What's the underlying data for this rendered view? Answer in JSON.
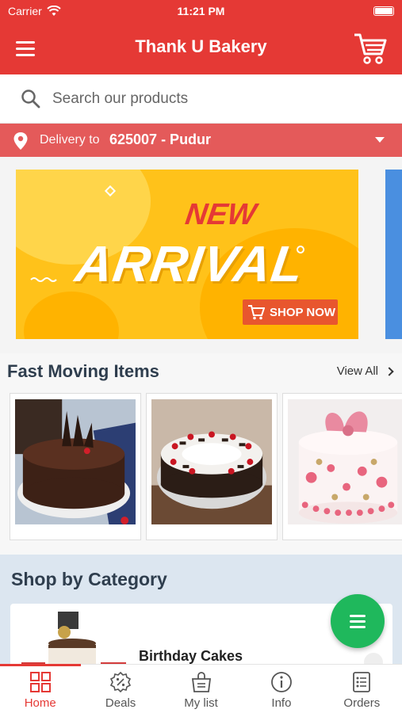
{
  "status_bar": {
    "carrier": "Carrier",
    "time": "11:21 PM"
  },
  "header": {
    "title": "Thank U Bakery"
  },
  "search": {
    "placeholder": "Search our products"
  },
  "delivery": {
    "label": "Delivery to",
    "location": "625007 - Pudur"
  },
  "banner": {
    "line1": "NEW",
    "line2": "ARRIVAL",
    "cta": "SHOP NOW"
  },
  "fast_moving": {
    "title": "Fast Moving Items",
    "view_all": "View All",
    "items": [
      {
        "icon": "chocolate-cake-image"
      },
      {
        "icon": "black-forest-cake-image"
      },
      {
        "icon": "pink-fondant-cake-image"
      }
    ]
  },
  "categories": {
    "title": "Shop by Category",
    "items": [
      {
        "name": "Birthday Cakes"
      }
    ]
  },
  "tabs": [
    {
      "label": "Home",
      "icon": "home-grid-icon",
      "active": true
    },
    {
      "label": "Deals",
      "icon": "deals-badge-icon",
      "active": false
    },
    {
      "label": "My list",
      "icon": "shopping-bag-icon",
      "active": false
    },
    {
      "label": "Info",
      "icon": "info-icon",
      "active": false
    },
    {
      "label": "Orders",
      "icon": "orders-icon",
      "active": false
    }
  ],
  "colors": {
    "primary": "#e53935",
    "fab": "#1fb85c",
    "category_bg": "#dce6f0"
  }
}
